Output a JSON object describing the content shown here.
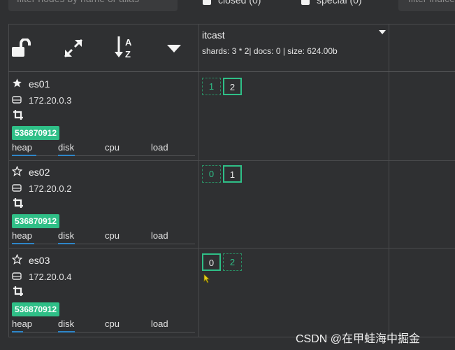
{
  "topbar": {
    "filter_placeholder": "filter nodes by name or alias",
    "checkbox_closed": "closed (0)",
    "checkbox_special": "special (0)",
    "filter2_placeholder": "filter indices"
  },
  "index": {
    "name": "itcast",
    "info": "shards: 3 * 2| docs: 0 | size: 624.00b"
  },
  "nodes": [
    {
      "name": "es01",
      "master": true,
      "ip": "172.20.0.3",
      "id": "536870912",
      "metrics": [
        "heap",
        "disk",
        "cpu",
        "load"
      ],
      "shards": [
        "1",
        "2"
      ]
    },
    {
      "name": "es02",
      "master": false,
      "ip": "172.20.0.2",
      "id": "536870912",
      "metrics": [
        "heap",
        "disk",
        "cpu",
        "load"
      ],
      "shards": [
        "0",
        "1"
      ]
    },
    {
      "name": "es03",
      "master": false,
      "ip": "172.20.0.4",
      "id": "536870912",
      "metrics": [
        "heap",
        "disk",
        "cpu",
        "load"
      ],
      "shards": [
        "0",
        "2"
      ]
    }
  ],
  "icons": {
    "lock": "unlock-icon",
    "expand": "expand-icon",
    "sort": "sort-alpha-icon",
    "menu": "caret-down-icon",
    "master": "star-icon",
    "host": "drive-icon",
    "crop": "crop-icon"
  },
  "colors": {
    "accent": "#2fbf87",
    "bar": "#2e86c9",
    "background": "#2f3032"
  },
  "watermark": "CSDN @在甲蛙海中掘金"
}
